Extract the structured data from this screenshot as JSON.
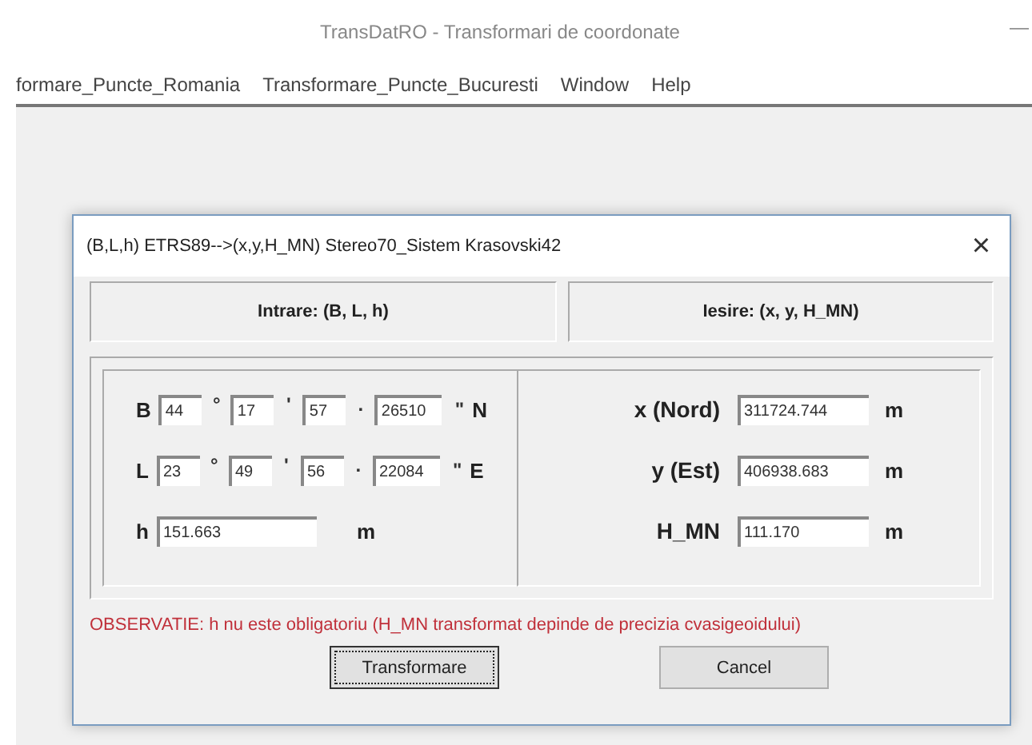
{
  "window": {
    "title": "TransDatRO - Transformari de coordonate",
    "minimize": "—"
  },
  "menu": [
    "formare_Puncte_Romania",
    "Transformare_Puncte_Bucuresti",
    "Window",
    "Help"
  ],
  "dialog": {
    "title": "(B,L,h) ETRS89-->(x,y,H_MN) Stereo70_Sistem Krasovski42",
    "close": "×",
    "input_header": "Intrare: (B, L, h)",
    "output_header": "Iesire: (x, y, H_MN)",
    "angles": [
      {
        "label": "B",
        "deg": "44",
        "deg_sign": "°",
        "min": "17",
        "min_sign": "'",
        "sec": "57",
        "dot": ".",
        "frac": "26510",
        "sec_sign": "\"",
        "hemi": "N"
      },
      {
        "label": "L",
        "deg": "23",
        "deg_sign": "°",
        "min": "49",
        "min_sign": "'",
        "sec": "56",
        "dot": ".",
        "frac": "22084",
        "sec_sign": "\"",
        "hemi": "E"
      }
    ],
    "height": {
      "label": "h",
      "value": "151.663",
      "unit": "m"
    },
    "outputs": [
      {
        "label": "x (Nord)",
        "value": "311724.744",
        "unit": "m"
      },
      {
        "label": "y (Est)",
        "value": "406938.683",
        "unit": "m"
      },
      {
        "label": "H_MN",
        "value": "111.170",
        "unit": "m"
      }
    ],
    "note": "OBSERVATIE: h nu este obligatoriu (H_MN transformat depinde de precizia cvasigeoidului)",
    "buttons": [
      {
        "label": "Transformare",
        "focused": true
      },
      {
        "label": "Cancel",
        "focused": false
      }
    ]
  }
}
